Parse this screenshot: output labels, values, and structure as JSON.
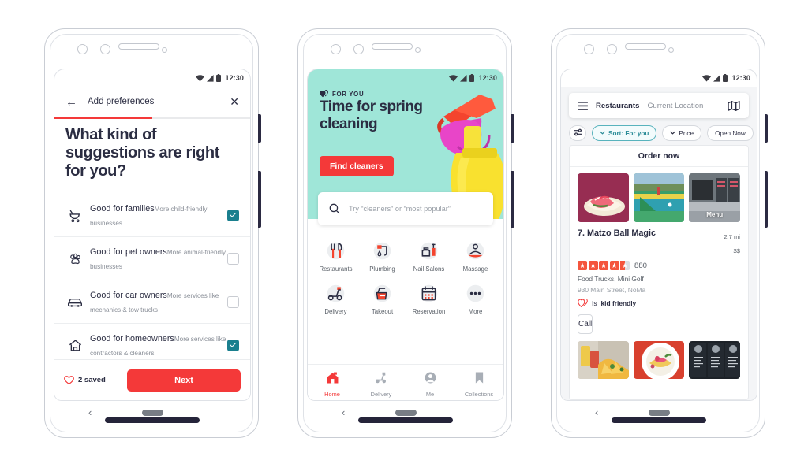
{
  "status_bar": {
    "time": "12:30",
    "icons": [
      "wifi-icon",
      "signal-icon",
      "battery-icon"
    ]
  },
  "phone1": {
    "header": {
      "back": "←",
      "title": "Add preferences",
      "close": "✕"
    },
    "progress_percent": 50,
    "heading": "What kind of suggestions are right for you?",
    "preferences": [
      {
        "icon": "stroller-icon",
        "title": "Good for families",
        "subtitle": "More child-friendly businesses",
        "checked": true
      },
      {
        "icon": "paw-icon",
        "title": "Good for pet owners",
        "subtitle": "More animal-friendly businesses",
        "checked": false
      },
      {
        "icon": "car-icon",
        "title": "Good for car owners",
        "subtitle": "More services like mechanics & tow trucks",
        "checked": false
      },
      {
        "icon": "house-icon",
        "title": "Good for homeowners",
        "subtitle": "More services like contractors & cleaners",
        "checked": true
      }
    ],
    "footer": {
      "saved_label": "2 saved",
      "saved_icon": "heart-icon",
      "next_label": "Next"
    },
    "colors": {
      "accent_red": "#F43939",
      "checkbox_teal": "#1A7F8E"
    }
  },
  "phone2": {
    "banner": {
      "eyebrow": "FOR YOU",
      "eyebrow_icon": "double-heart-icon",
      "title": "Time for spring cleaning",
      "cta": "Find cleaners",
      "background_color": "#9FE6D8",
      "illustration": "spray-bottle-gloved-hand"
    },
    "search": {
      "placeholder": "Try “cleaners” or “most popular”",
      "icon": "search-icon"
    },
    "categories": [
      {
        "icon": "utensils-icon",
        "label": "Restaurants"
      },
      {
        "icon": "faucet-icon",
        "label": "Plumbing"
      },
      {
        "icon": "nailpolish-icon",
        "label": "Nail Salons"
      },
      {
        "icon": "massage-icon",
        "label": "Massage"
      },
      {
        "icon": "scooter-icon",
        "label": "Delivery"
      },
      {
        "icon": "takeout-icon",
        "label": "Takeout"
      },
      {
        "icon": "calendar-icon",
        "label": "Reservation"
      },
      {
        "icon": "ellipsis-icon",
        "label": "More"
      }
    ],
    "tabs": [
      {
        "icon": "home-icon",
        "label": "Home",
        "active": true
      },
      {
        "icon": "scooter-icon",
        "label": "Delivery",
        "active": false
      },
      {
        "icon": "person-icon",
        "label": "Me",
        "active": false
      },
      {
        "icon": "bookmark-icon",
        "label": "Collections",
        "active": false
      }
    ]
  },
  "phone3": {
    "search": {
      "menu_icon": "hamburger-icon",
      "term": "Restaurants",
      "location": "Current Location",
      "map_icon": "map-icon"
    },
    "chips": [
      {
        "label": "",
        "icon": "filter-icon",
        "active": false,
        "round": true
      },
      {
        "label": "Sort: For you",
        "icon": "chevron-down-icon",
        "active": true
      },
      {
        "label": "Price",
        "icon": "chevron-down-icon",
        "active": false
      },
      {
        "label": "Open Now",
        "icon": "",
        "active": false
      }
    ],
    "order_now": "Order now",
    "photos": [
      {
        "name": "lobster-roll-photo",
        "label": ""
      },
      {
        "name": "mini-golf-photo",
        "label": ""
      },
      {
        "name": "food-truck-photo",
        "label": "Menu"
      }
    ],
    "listing": {
      "name": "7. Matzo Ball Magic",
      "distance": "2.7 mi",
      "price": "$$",
      "rating": 4.5,
      "review_count": "880",
      "categories": "Food Trucks, Mini Golf",
      "address": "930 Main Street, NoMa",
      "highlight_prefix": "Is",
      "highlight": "kid friendly",
      "highlight_icon": "double-heart-icon",
      "call_label": "Call"
    },
    "photos2": [
      {
        "name": "nachos-drinks-photo"
      },
      {
        "name": "tacos-plate-photo"
      },
      {
        "name": "chalkboard-menu-photo"
      }
    ]
  }
}
